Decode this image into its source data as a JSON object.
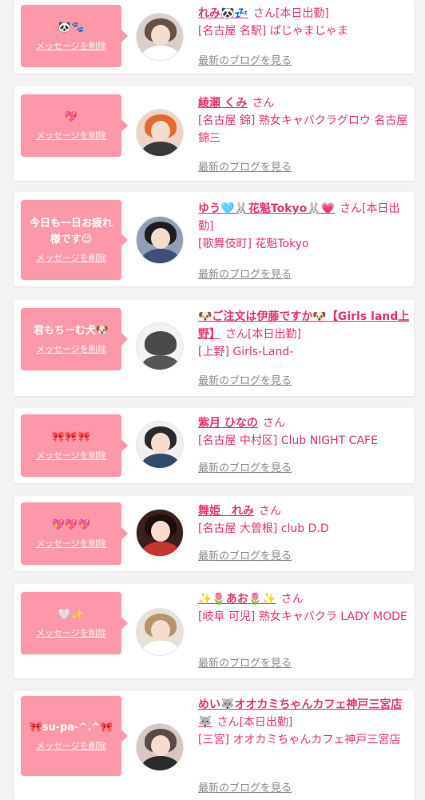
{
  "common": {
    "delete_label": "メッセージを削除",
    "blog_label": "最新のブログを見る",
    "san": "さん",
    "accent_color": "#fd98a8",
    "name_color": "#e6356f"
  },
  "items": [
    {
      "message": "🐼🐾",
      "name": "れみ🐼💤",
      "status": "[本日出勤]",
      "shop": "[名古屋 名駅] ぱじゃまじゃま",
      "avatar_icon": "avatar-photo"
    },
    {
      "message": "💖",
      "name": "綾瀬 くみ",
      "status": "",
      "shop": "[名古屋 錦] 熟女キャバクラグロウ 名古屋錦三",
      "avatar_icon": "avatar-photo"
    },
    {
      "message": "今日も一日お疲れ様です😌",
      "name": "ゆう🩵🐰花魁Tokyo🐰💗",
      "status": "[本日出勤]",
      "shop": "[歌舞伎町] 花魁Tokyo",
      "avatar_icon": "avatar-photo"
    },
    {
      "message": "君もちーむ犬🐶",
      "name": "🐶ご注文は伊藤ですか🐶【Girls land上野】",
      "status": "[本日出勤]",
      "shop": "[上野] Girls-Land-",
      "avatar_icon": "avatar-photo"
    },
    {
      "message": "🎀🎀🎀",
      "name": "紫月 ひなの",
      "status": "",
      "shop": "[名古屋 中村区] Club NIGHT CAFE",
      "avatar_icon": "avatar-photo"
    },
    {
      "message": "💖💖💖",
      "name": "舞姫　れみ",
      "status": "",
      "shop": "[名古屋 大曽根] club D.D",
      "avatar_icon": "avatar-photo"
    },
    {
      "message": "🤍✨",
      "name": "✨🌷あお🌷✨",
      "status": "",
      "shop": "[岐阜 可児] 熟女キャバクラ LADY MODE",
      "avatar_icon": "avatar-photo"
    },
    {
      "message": "🎀su-pa-^.^🎀",
      "name": "めい🐺オオカミちゃんカフェ神戸三宮店🐺",
      "status": "[本日出勤]",
      "shop": "[三宮] オオカミちゃんカフェ神戸三宮店",
      "avatar_icon": "avatar-photo"
    }
  ]
}
